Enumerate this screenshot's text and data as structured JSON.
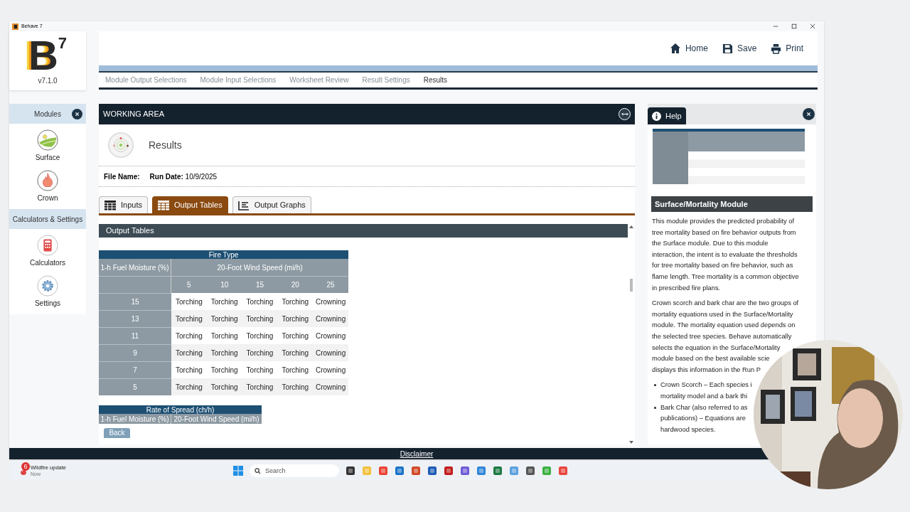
{
  "window": {
    "title": "Behave 7"
  },
  "logo": {
    "letter": "B",
    "superscript": "7",
    "version": "v7.1.0"
  },
  "top_actions": [
    {
      "kind": "home",
      "label": "Home"
    },
    {
      "kind": "save",
      "label": "Save"
    },
    {
      "kind": "print",
      "label": "Print"
    }
  ],
  "steps": [
    {
      "label": "Module Output Selections",
      "selected": false
    },
    {
      "label": "Module Input Selections",
      "selected": false
    },
    {
      "label": "Worksheet Review",
      "selected": false
    },
    {
      "label": "Result Settings",
      "selected": false
    },
    {
      "label": "Results",
      "selected": true
    }
  ],
  "sidebar": {
    "sections": [
      {
        "title": "Modules",
        "closable": true,
        "items": [
          {
            "kind": "surface",
            "label": "Surface"
          },
          {
            "kind": "crown",
            "label": "Crown"
          }
        ]
      },
      {
        "title": "Calculators & Settings",
        "closable": false,
        "items": [
          {
            "kind": "calculator",
            "label": "Calculators"
          },
          {
            "kind": "settings",
            "label": "Settings"
          }
        ]
      }
    ]
  },
  "working_area": {
    "title": "WORKING AREA",
    "page_title": "Results",
    "file_name_label": "File Name:",
    "run_date_label": "Run Date:",
    "run_date": "10/9/2025",
    "tabs": [
      {
        "kind": "table",
        "label": "Inputs",
        "selected": false
      },
      {
        "kind": "table",
        "label": "Output Tables",
        "selected": true
      },
      {
        "kind": "graph",
        "label": "Output Graphs",
        "selected": false
      }
    ],
    "section_title": "Output Tables",
    "table": {
      "title": "Fire Type",
      "row_header": "1-h Fuel Moisture (%)",
      "column_group": "20-Foot Wind Speed (mi/h)",
      "columns": [
        "5",
        "10",
        "15",
        "20",
        "25"
      ],
      "rows": [
        {
          "moisture": "15",
          "cells": [
            "Torching",
            "Torching",
            "Torching",
            "Torching",
            "Crowning"
          ]
        },
        {
          "moisture": "13",
          "cells": [
            "Torching",
            "Torching",
            "Torching",
            "Torching",
            "Crowning"
          ]
        },
        {
          "moisture": "11",
          "cells": [
            "Torching",
            "Torching",
            "Torching",
            "Torching",
            "Crowning"
          ]
        },
        {
          "moisture": "9",
          "cells": [
            "Torching",
            "Torching",
            "Torching",
            "Torching",
            "Crowning"
          ]
        },
        {
          "moisture": "7",
          "cells": [
            "Torching",
            "Torching",
            "Torching",
            "Torching",
            "Crowning"
          ]
        },
        {
          "moisture": "5",
          "cells": [
            "Torching",
            "Torching",
            "Torching",
            "Torching",
            "Crowning"
          ]
        }
      ]
    },
    "table_2": {
      "title": "Rate of Spread (ch/h)",
      "row_header": "1-h Fuel Moisture (%)",
      "column_group": "20-Foot Wind Speed (mi/h)"
    },
    "back_button": "Back"
  },
  "help": {
    "title": "Help",
    "heading": "Surface/Mortality Module",
    "paragraphs": [
      [
        "This module provides the predicted probability of",
        "tree mortality based on fire behavior outputs from",
        "the Surface module. Due to this module",
        "interaction, the intent is to evaluate the thresholds",
        "for tree mortality based on fire behavior, such as",
        "flame length. Tree mortality is a common objective",
        "in prescribed fire plans."
      ],
      [
        "Crown scorch and bark char are the two groups of",
        "mortality equations used in the Surface/Mortality",
        "module. The mortality equation used depends on",
        "the selected tree species. Behave automatically",
        "selects the equation in the Surface/Mortality",
        "module based on the best available scie",
        "displays this information in the Run P"
      ]
    ],
    "bullets": [
      [
        "Crown Scorch – Each species i",
        "mortality model and a bark thi"
      ],
      [
        "Bark Char (also referred to as",
        "publications) – Equations are",
        "hardwood species."
      ]
    ]
  },
  "footer": {
    "disclaimer": "Disclaimer"
  },
  "taskbar": {
    "notification": {
      "badge": "6",
      "title": "Wildfire update",
      "time": "Now"
    },
    "search_placeholder": "Search"
  }
}
